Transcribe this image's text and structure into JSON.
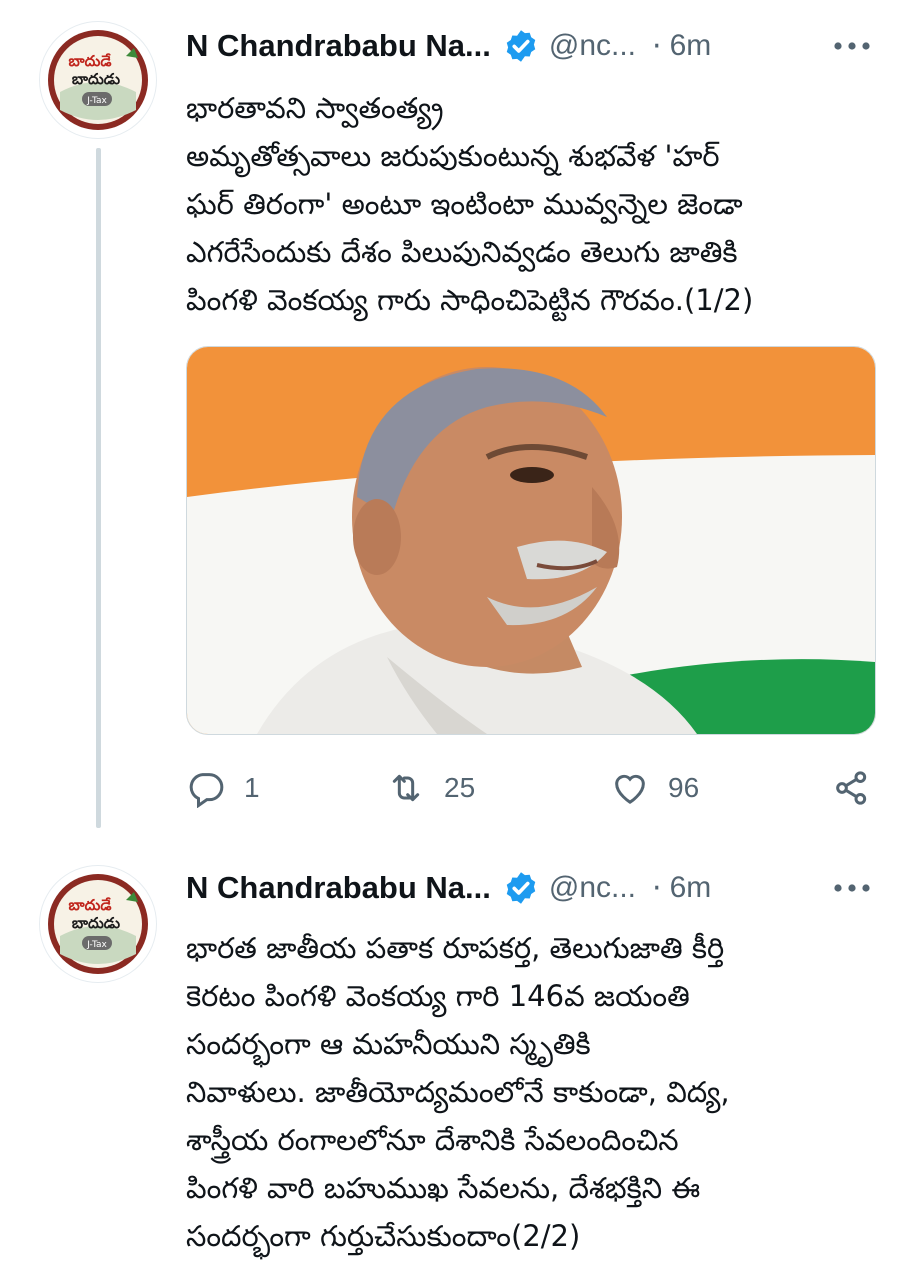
{
  "tweets": [
    {
      "author_name": "N Chandrababu Na...",
      "handle": "@nc...",
      "separator": "·",
      "time": "6m",
      "text": "భారతావని స్వాతంత్య్ర \nఅమృతోత్సవాలు జరుపుకుంటున్న శుభవేళ 'హర్\nఘర్ తిరంగా' అంటూ ఇంటింటా మువ్వన్నెల జెండా\nఎగరేసేందుకు దేశం పిలుపునివ్వడం తెలుగు జాతికి\nపింగళి వెంకయ్య గారు సాధించిపెట్టిన గౌరవం.(1/2)",
      "avatar_logo_text": [
        "బాదుడే",
        "బాదుడు",
        "J-Tax"
      ],
      "actions": {
        "reply_count": "1",
        "retweet_count": "25",
        "like_count": "96"
      }
    },
    {
      "author_name": "N Chandrababu Na...",
      "handle": "@nc...",
      "separator": "·",
      "time": "6m",
      "text": "భారత జాతీయ పతాక రూపకర్త, తెలుగుజాతి కీర్తి\nకెరటం పింగళి వెంకయ్య గారి 146వ జయంతి\nసందర్భంగా ఆ మహనీయుని స్మృతికి\nనివాళులు. జాతీయోద్యమంలోనే కాకుండా, విద్య,\nశాస్త్రీయ రంగాలలోనూ దేశానికి సేవలందించిన\nపింగళి వారి బహుముఖ సేవలను, దేశభక్తిని ఈ\nసందర్భంగా గుర్తుచేసుకుందాం(2/2)",
      "avatar_logo_text": [
        "బాదుడే",
        "బాదుడు",
        "J-Tax"
      ]
    }
  ],
  "colors": {
    "verified": "#1d9bf0",
    "saffron": "#f2923a",
    "green": "#1e9e4a",
    "muted": "#536471"
  },
  "icons": [
    "verified-badge-icon",
    "more-icon",
    "reply-icon",
    "retweet-icon",
    "like-icon",
    "share-icon"
  ]
}
